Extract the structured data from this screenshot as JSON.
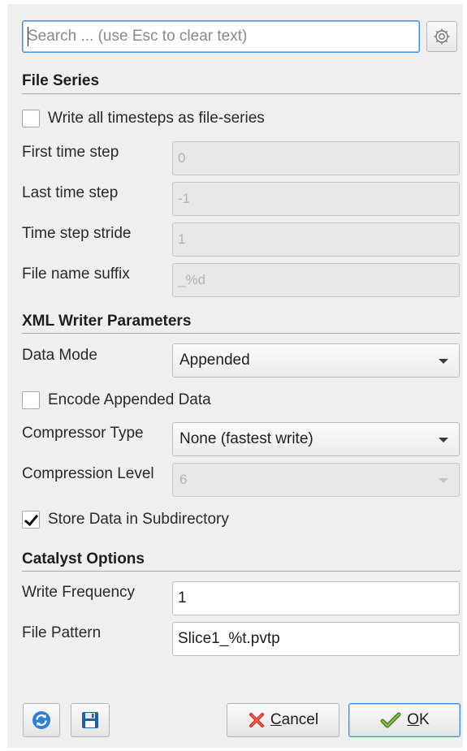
{
  "search": {
    "placeholder": "Search ... (use Esc to clear text)",
    "value": "",
    "gear_icon": "gear-icon"
  },
  "file_series": {
    "title": "File Series",
    "write_all_label": "Write all timesteps as file-series",
    "write_all_checked": false,
    "first_time_step_label": "First time step",
    "first_time_step_value": "0",
    "last_time_step_label": "Last time step",
    "last_time_step_value": "-1",
    "time_step_stride_label": "Time step stride",
    "time_step_stride_value": "1",
    "file_name_suffix_label": "File name suffix",
    "file_name_suffix_value": "_%d"
  },
  "xml_writer": {
    "title": "XML Writer Parameters",
    "data_mode_label": "Data Mode",
    "data_mode_value": "Appended",
    "encode_appended_label": "Encode Appended Data",
    "encode_appended_checked": false,
    "compressor_type_label": "Compressor Type",
    "compressor_type_value": "None (fastest write)",
    "compression_level_label": "Compression Level",
    "compression_level_value": "6",
    "store_subdir_label": "Store Data in Subdirectory",
    "store_subdir_checked": true
  },
  "catalyst": {
    "title": "Catalyst Options",
    "write_frequency_label": "Write Frequency",
    "write_frequency_value": "1",
    "file_pattern_label": "File Pattern",
    "file_pattern_value": "Slice1_%t.pvtp"
  },
  "buttons": {
    "reset_icon": "refresh-icon",
    "save_icon": "save-icon",
    "cancel_mnemonic": "C",
    "cancel_rest": "ancel",
    "cancel_icon": "red-x-icon",
    "ok_mnemonic": "O",
    "ok_rest": "K",
    "ok_icon": "green-check-icon"
  },
  "colors": {
    "focus_border": "#3d8ee0",
    "dialog_bg": "#efefef"
  }
}
